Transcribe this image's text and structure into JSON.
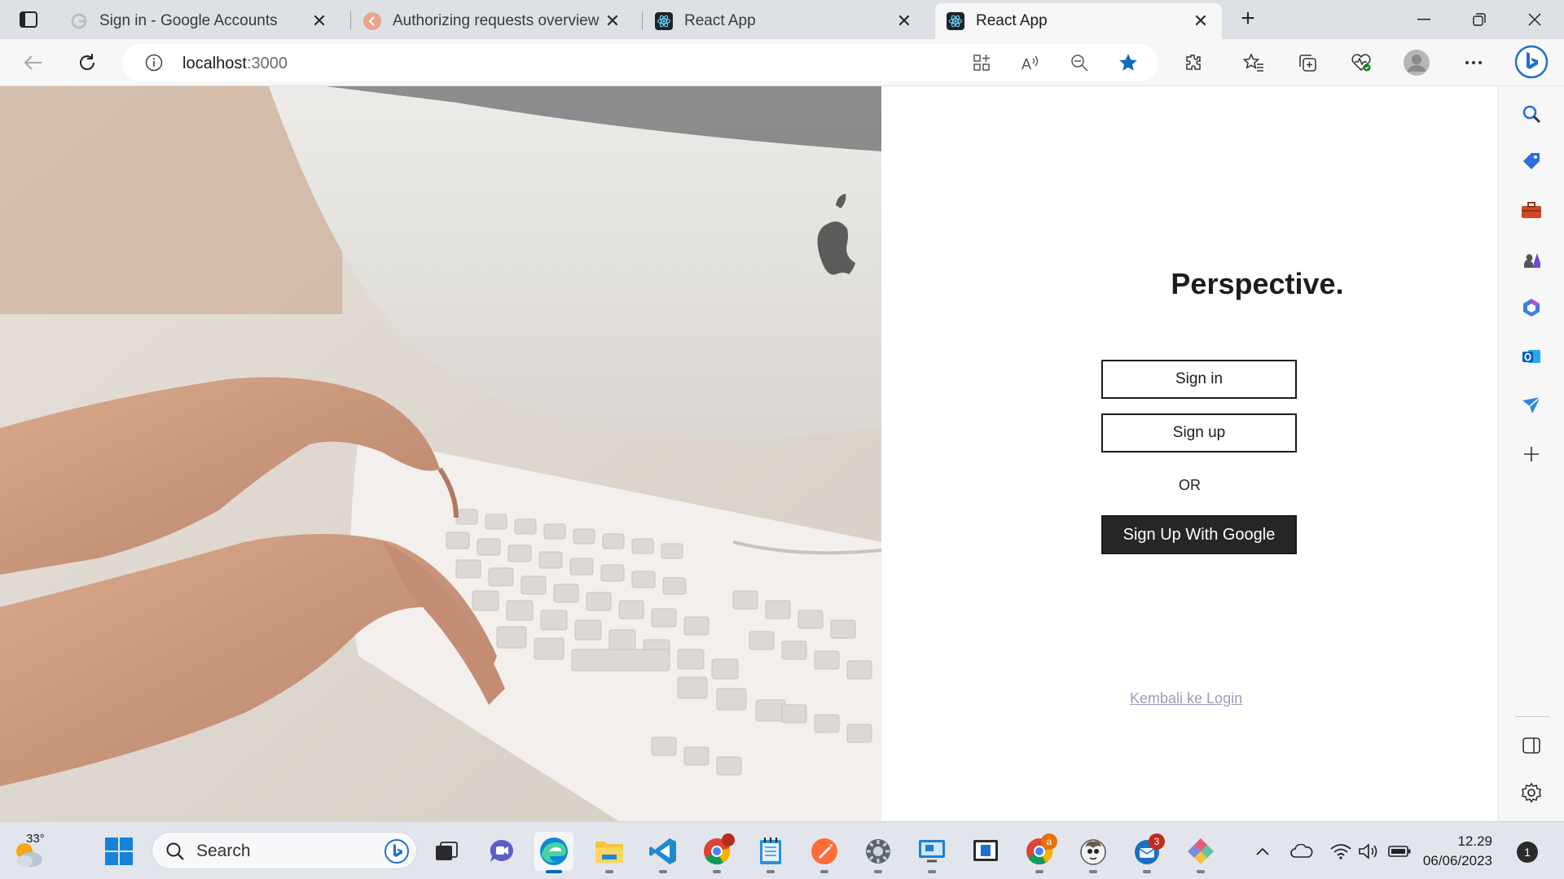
{
  "browser": {
    "tabs": [
      {
        "title": "Sign in - Google Accounts",
        "favicon": "google-icon",
        "active": false
      },
      {
        "title": "Authorizing requests overview | F",
        "favicon": "firebase-icon",
        "active": false
      },
      {
        "title": "React App",
        "favicon": "react-icon",
        "active": false
      },
      {
        "title": "React App",
        "favicon": "react-icon",
        "active": true
      }
    ],
    "address": {
      "host": "localhost",
      "port": ":3000"
    }
  },
  "page": {
    "brand": "Perspective.",
    "signin_label": "Sign in",
    "signup_label": "Sign up",
    "or_label": "OR",
    "google_label": "Sign Up With Google",
    "back_link": "Kembali ke Login"
  },
  "taskbar": {
    "temperature": "33°",
    "search_label": "Search",
    "badges": {
      "chrome_dev": "a",
      "thunderbird": "3"
    },
    "time": "12.29",
    "date": "06/06/2023",
    "notification_count": "1"
  },
  "colors": {
    "accent": "#0067c0",
    "dark_button": "#262626",
    "link": "#9c9cb8"
  }
}
